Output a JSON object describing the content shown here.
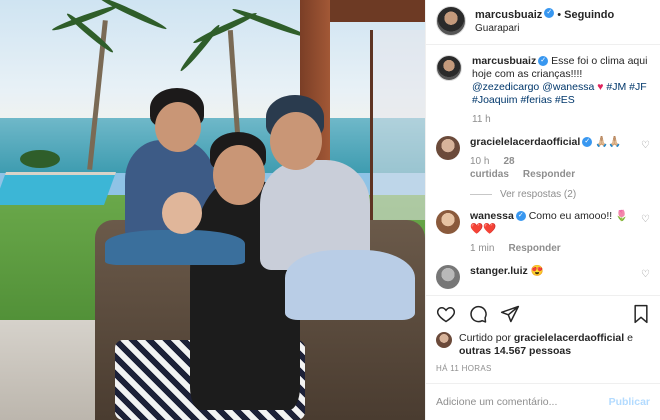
{
  "header": {
    "username": "marcusbuaiz",
    "separator": "•",
    "follow_label": "Seguindo",
    "location": "Guarapari"
  },
  "caption": {
    "username": "marcusbuaiz",
    "text": "Esse foi o clima aqui hoje com as crianças!!!!",
    "mention1": "@zezedicargo",
    "mention2": "@wanessa",
    "tag_jm": "#JM",
    "tags": "#JF #Joaquim #ferias #ES",
    "time": "11 h"
  },
  "comments": [
    {
      "username": "gracielelacerdaofficial",
      "text": "🙏🏼🙏🏼",
      "time": "10 h",
      "likes": "28 curtidas",
      "reply": "Responder",
      "view_replies": "Ver respostas (2)"
    },
    {
      "username": "wanessa",
      "text": "Como eu amooo!! 🌷",
      "text2": "❤️❤️",
      "time": "1 min",
      "reply": "Responder"
    },
    {
      "username": "stanger.luiz",
      "text": "😍"
    }
  ],
  "likes": {
    "prefix": "Curtido por",
    "user": "gracielelacerdaofficial",
    "connector": "e",
    "others": "outras 14.567 pessoas"
  },
  "date": "HÁ 11 HORAS",
  "comment_box": {
    "placeholder": "Adicione um comentário...",
    "publish": "Publicar"
  },
  "colors": {
    "verified": "#3897f0",
    "link": "#00376b",
    "muted": "#8e8e8e",
    "publish_disabled": "#b3dbff"
  }
}
